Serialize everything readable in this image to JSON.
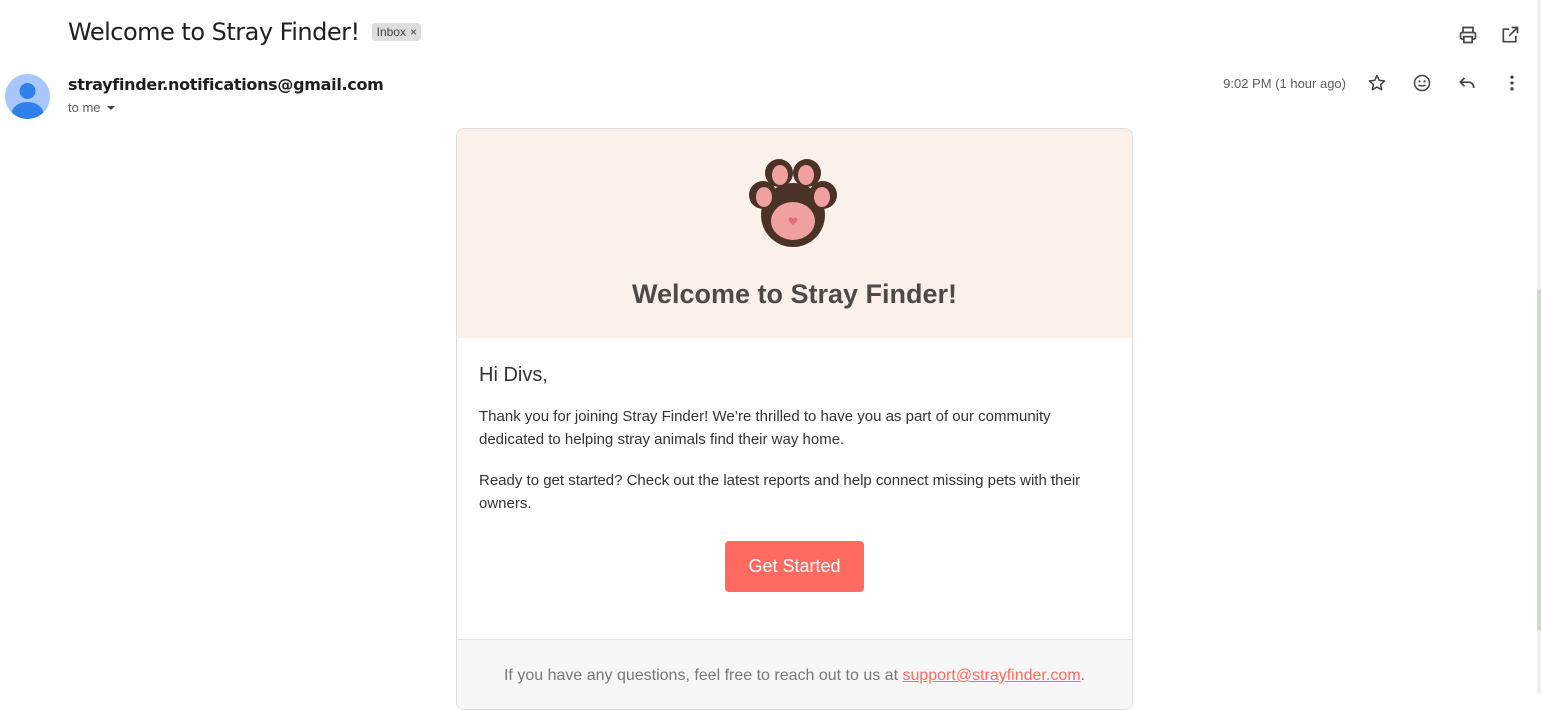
{
  "email": {
    "subject": "Welcome to Stray Finder!",
    "label": "Inbox",
    "label_close": "×",
    "sender": "strayfinder.notifications@gmail.com",
    "recipient": "to me",
    "time": "9:02 PM (1 hour ago)"
  },
  "icons": {
    "print": "print-icon",
    "open_new": "open-in-new-window-icon",
    "star": "star-icon",
    "emoji": "emoji-icon",
    "reply": "reply-icon",
    "more": "more-vertical-icon",
    "avatar": "user-avatar-icon",
    "dropdown": "dropdown-icon",
    "logo": "paw-icon"
  },
  "message": {
    "header_title": "Welcome to Stray Finder!",
    "greeting": "Hi Divs,",
    "para1": "Thank you for joining Stray Finder! We’re thrilled to have you as part of our community dedicated to helping stray animals find their way home.",
    "para2": "Ready to get started? Check out the latest reports and help connect missing pets with their owners.",
    "cta_label": "Get Started",
    "footer_text": "If you have any questions, feel free to reach out to us at ",
    "footer_link": "support@strayfinder.com",
    "footer_end": "."
  },
  "colors": {
    "header_bg": "#fbf1ea",
    "cta_bg": "#ff6b61",
    "avatar_bg": "#a8c7fa"
  }
}
